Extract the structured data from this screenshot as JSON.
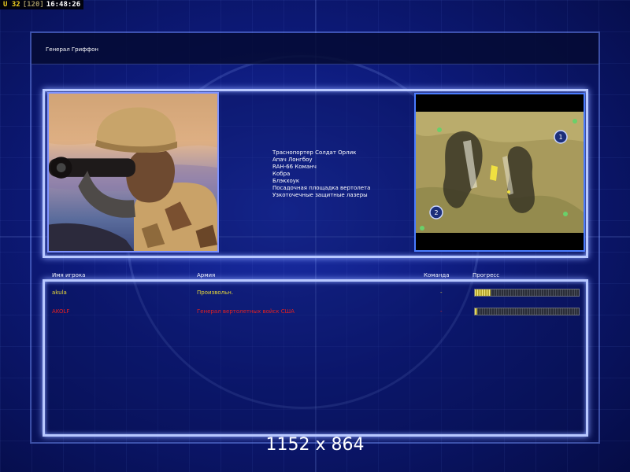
{
  "hud": {
    "unit": "U 32",
    "count": "[120]",
    "time": "16:48:26"
  },
  "general": {
    "title": "Генерал Гриффон"
  },
  "units": [
    "Траснопортер Солдат Орлик",
    "Апач Лонгбоу",
    "RAH-66 Команч",
    "Кобра",
    "Блэкхоук",
    "Посадочная площадка вертолета",
    "Узкоточечные защитные лазеры"
  ],
  "columns": {
    "player": "Имя игрока",
    "army": "Армия",
    "team": "Команда",
    "progress": "Прогресс"
  },
  "players": [
    {
      "name": "akula",
      "army": "Произвольн.",
      "team": "-",
      "progress": 0.15,
      "color": "#e8d838"
    },
    {
      "name": "AKOLF",
      "army": "Генерал вертолетных войск США",
      "team": "-",
      "progress": 0.02,
      "color": "#e62020"
    }
  ],
  "minimap": {
    "start_positions": [
      "1",
      "2"
    ]
  },
  "overlay": {
    "resolution": "1152 x 864"
  }
}
